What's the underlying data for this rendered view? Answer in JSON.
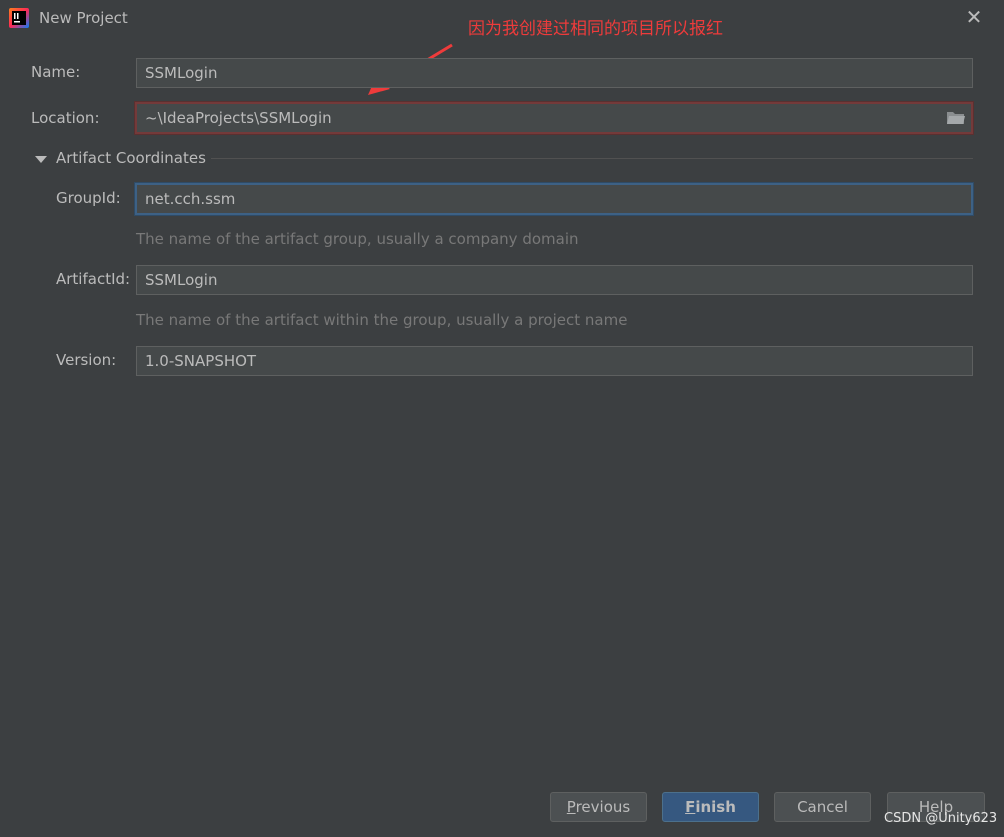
{
  "window": {
    "title": "New Project",
    "icon": "intellij-idea-icon"
  },
  "annotation": {
    "text": "因为我创建过相同的项目所以报红",
    "color": "#ee3b3b"
  },
  "form": {
    "name": {
      "label": "Name:",
      "value": "SSMLogin"
    },
    "location": {
      "label": "Location:",
      "value": "~\\IdeaProjects\\SSMLogin",
      "state": "error",
      "icon": "folder-icon"
    },
    "artifact_section": {
      "title": "Artifact Coordinates",
      "expanded": true
    },
    "group_id": {
      "label": "GroupId:",
      "value": "net.cch.ssm",
      "hint": "The name of the artifact group, usually a company domain",
      "state": "focused"
    },
    "artifact_id": {
      "label": "ArtifactId:",
      "value": "SSMLogin",
      "hint": "The name of the artifact within the group, usually a project name"
    },
    "version": {
      "label": "Version:",
      "value": "1.0-SNAPSHOT"
    }
  },
  "buttons": {
    "previous": {
      "mnemonic": "P",
      "rest": "revious"
    },
    "finish": {
      "mnemonic": "F",
      "rest": "inish"
    },
    "cancel": "Cancel",
    "help": "Help"
  },
  "watermark": "CSDN @Unity623",
  "colors": {
    "background": "#3c3f41",
    "field": "#45494a",
    "primary": "#365880",
    "error_border": "#743a3a",
    "focus_border": "#3d6185"
  }
}
